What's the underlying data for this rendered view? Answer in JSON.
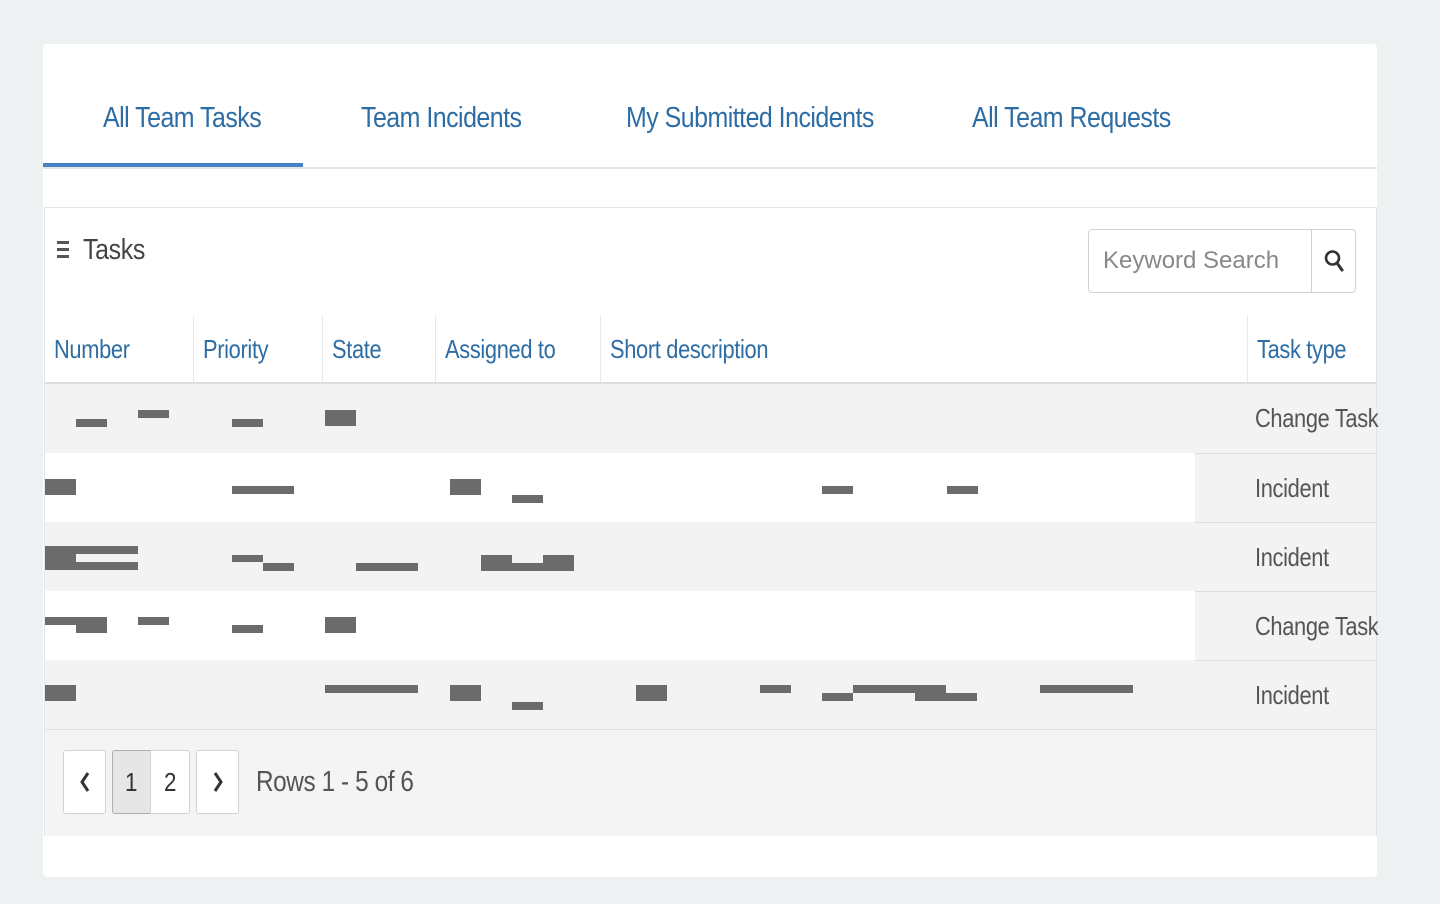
{
  "tabs": [
    {
      "label": "All Team Tasks",
      "active": true
    },
    {
      "label": "Team Incidents",
      "active": false
    },
    {
      "label": "My Submitted Incidents",
      "active": false
    },
    {
      "label": "All Team Requests",
      "active": false
    }
  ],
  "panel": {
    "title": "Tasks",
    "menu_icon": "hamburger-menu-icon",
    "search": {
      "placeholder": "Keyword Search",
      "value": "",
      "icon": "search-icon"
    }
  },
  "table": {
    "columns": [
      "Number",
      "Priority",
      "State",
      "Assigned to",
      "Short description",
      "Task type"
    ],
    "rows": [
      {
        "task_type": "Change Task"
      },
      {
        "task_type": "Incident"
      },
      {
        "task_type": "Incident"
      },
      {
        "task_type": "Change Task"
      },
      {
        "task_type": "Incident"
      }
    ]
  },
  "pagination": {
    "prev_icon": "chevron-left-icon",
    "next_icon": "chevron-right-icon",
    "pages": [
      "1",
      "2"
    ],
    "current_page": "1",
    "rows_info": "Rows 1 - 5 of 6"
  },
  "colors": {
    "accent": "#2e6da4",
    "tab_underline": "#4682c4",
    "background": "#eef1f2",
    "redaction": "#6b6b6b"
  }
}
